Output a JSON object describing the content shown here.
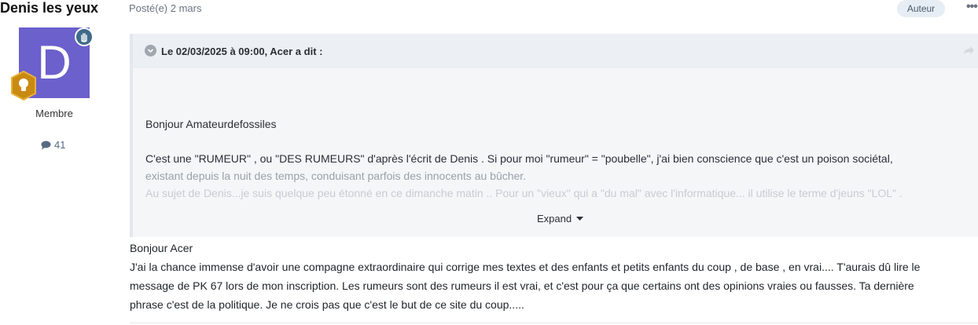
{
  "author": {
    "name": "Denis les yeux",
    "avatar_letter": "D",
    "avatar_color": "#6b60cc",
    "role": "Membre",
    "post_count": "41"
  },
  "post": {
    "posted_label": "Posté(e) 2 mars",
    "author_badge": "Auteur",
    "more_menu": "•••"
  },
  "quote": {
    "citation": "Le 02/03/2025 à 09:00, Acer a dit :",
    "lines": [
      "Bonjour Amateurdefossiles",
      "C'est une \"RUMEUR\" , ou \"DES RUMEURS\" d'après l'écrit de Denis . Si pour moi \"rumeur\" = \"poubelle\", j'ai bien conscience que c'est un poison sociétal,",
      "existant depuis la nuit des temps, conduisant parfois des innocents au bûcher.",
      "Au sujet de Denis...je suis quelque peu étonné en ce dimanche matin .. Pour un \"vieux\" qui a  \"du mal\" avec l'informatique... il utilise le terme d'jeuns \"LOL\" ."
    ],
    "expand_label": "Expand"
  },
  "reply": {
    "lines": [
      " Bonjour Acer",
      "J'ai la chance immense d'avoir une compagne extraordinaire qui corrige mes textes et des enfants et petits enfants du coup , de base , en vrai.... T'aurais dû lire le",
      "message de PK 67 lors de mon inscription. Les rumeurs sont des rumeurs il est vrai, et c'est pour ça que certains ont des opinions vraies ou fausses. Ta dernière",
      "phrase c'est de la politique. Je ne crois pas que c'est le but de ce site du coup....."
    ]
  }
}
